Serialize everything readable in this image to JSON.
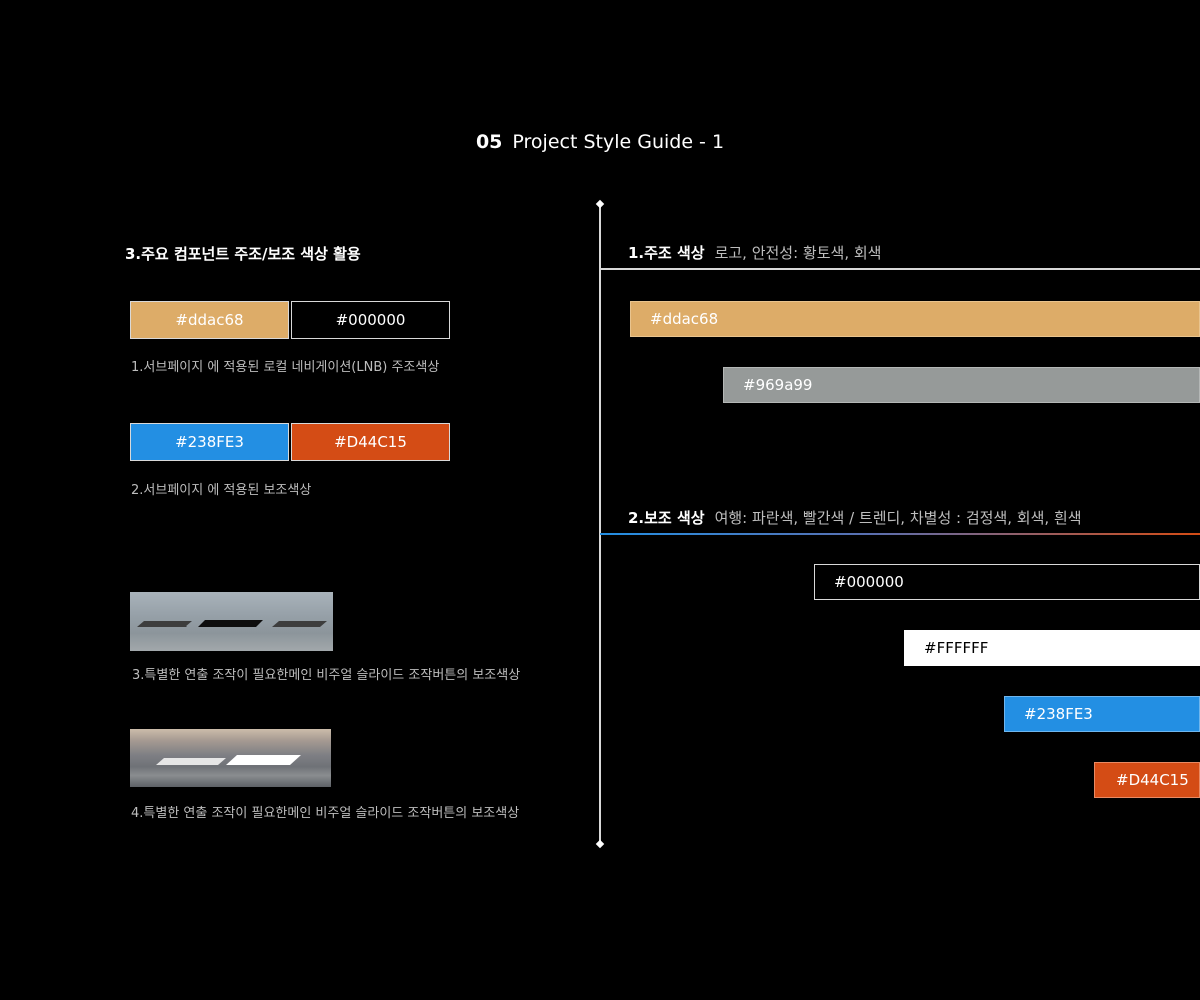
{
  "header": {
    "number": "05",
    "title": "Project Style Guide - 1"
  },
  "left": {
    "heading": "3.주요 컴포넌트 주조/보조 색상 활용",
    "group1": {
      "swatches": [
        {
          "label": "#ddac68",
          "color": "#ddac68",
          "text_color": "#ffffff"
        },
        {
          "label": "#000000",
          "color": "#000000",
          "text_color": "#ffffff"
        }
      ],
      "caption": "1.서브페이지 에 적용된 로컬 네비게이션(LNB)  주조색상"
    },
    "group2": {
      "swatches": [
        {
          "label": "#238FE3",
          "color": "#238FE3",
          "text_color": "#ffffff"
        },
        {
          "label": "#D44C15",
          "color": "#D44C15",
          "text_color": "#ffffff"
        }
      ],
      "caption": "2.서브페이지 에 적용된 보조색상"
    },
    "group3": {
      "caption": "3.특별한 연출 조작이 필요한메인 비주얼 슬라이드 조작버튼의 보조색상"
    },
    "group4": {
      "caption": "4.특별한 연출 조작이 필요한메인 비주얼 슬라이드 조작버튼의 보조색상"
    }
  },
  "right": {
    "primary": {
      "title": "1.주조 색상",
      "subtitle": "로고, 안전성: 황토색, 회색",
      "line_color": "#ffffff",
      "bars": [
        {
          "label": "#ddac68",
          "color": "#ddac68"
        },
        {
          "label": "#969a99",
          "color": "#969a99"
        }
      ]
    },
    "secondary": {
      "title": "2.보조 색상",
      "subtitle": "여행: 파란색, 빨간색 / 트렌디, 차별성 : 검정색, 회색, 흰색",
      "line_colors": [
        "#238FE3",
        "#D44C15"
      ],
      "bars": [
        {
          "label": "#000000",
          "color": "#000000"
        },
        {
          "label": "#FFFFFF",
          "color": "#FFFFFF"
        },
        {
          "label": "#238FE3",
          "color": "#238FE3"
        },
        {
          "label": "#D44C15",
          "color": "#D44C15"
        }
      ]
    }
  }
}
